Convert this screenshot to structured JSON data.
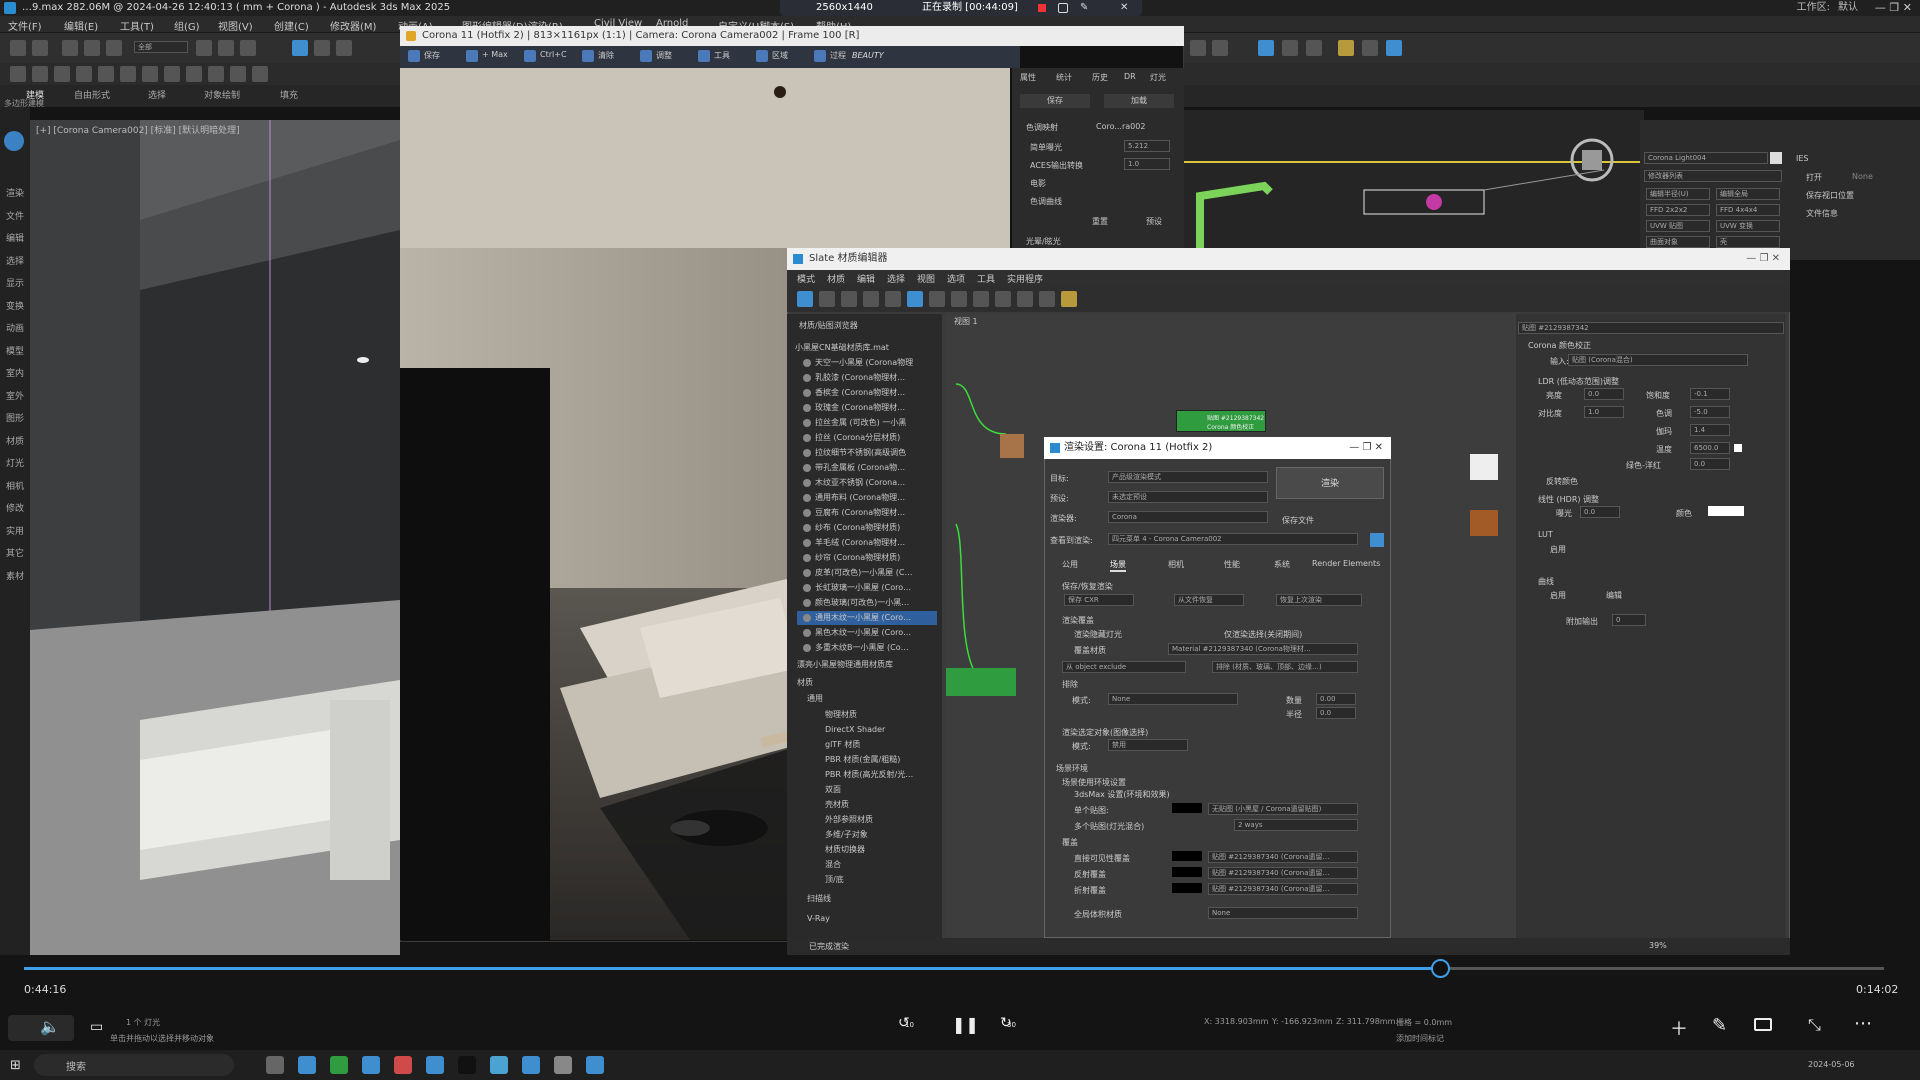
{
  "titlebar": {
    "title": "…9.max  282.06M @ 2024-04-26 12:40:13  ( mm + Corona ) - Autodesk 3ds Max 2025",
    "rec_res": "2560x1440",
    "rec_status": "正在录制 [00:44:09]",
    "workspace": "工作区:",
    "default": "默认"
  },
  "menu": [
    "文件(F)",
    "编辑(E)",
    "工具(T)",
    "组(G)",
    "视图(V)",
    "创建(C)",
    "修改器(M)",
    "动画(A)",
    "图形编辑器(D)",
    "渲染(R)",
    "Civil View",
    "Arnold",
    "自定义(U)",
    "脚本(S)",
    "帮助(H)"
  ],
  "toolbar": {
    "selector": "全部",
    "cmd_label": "多边形建模"
  },
  "ribbon_tabs": [
    "建模",
    "自由形式",
    "选择",
    "对象绘制",
    "填充"
  ],
  "left_items": [
    "渲染",
    "文件",
    "编辑",
    "选择",
    "显示",
    "变换",
    "动画",
    "模型",
    "室内",
    "室外",
    "图形",
    "材质",
    "灯光",
    "相机",
    "修改",
    "实用",
    "其它",
    "素材"
  ],
  "viewport_label": "[+] [Corona Camera002] [标准] [默认明暗处理]",
  "render_frame": {
    "title": "Corona 11 (Hotfix 2) | 813×1161px (1:1) | Camera: Corona Camera002 | Frame 100 [R]",
    "tools": [
      "保存",
      "+ Max",
      "Ctrl+C",
      "清除",
      "调整",
      "工具",
      "区域",
      "过程"
    ],
    "channel": "BEAUTY",
    "side_tabs": [
      "属性",
      "统计",
      "历史",
      "DR",
      "灯光"
    ],
    "save": "保存",
    "load": "加载",
    "tone_mapping": "色调映射",
    "tm_value": "Coro...ra002",
    "exposure": "简单曝光",
    "exposure_val": "5.212",
    "aces": "ACES输出转换",
    "aces_val": "1.0",
    "filmic": "电影",
    "curve": "色调曲线",
    "reset": "重置",
    "preset": "预设",
    "bloom": "光晕/眩光"
  },
  "cmd_panel": {
    "light_name": "Corona Light004",
    "modifier_list": "修改器列表",
    "ies": "IES",
    "on": "打开",
    "none": "None",
    "btns": [
      "编辑半径(U)",
      "编辑全局",
      "FFD 2x2x2",
      "FFD 4x4x4",
      "UVW 贴图",
      "UVW 变换",
      "曲面对象",
      "壳"
    ],
    "keep_viewport": "保存视口位置",
    "file_info": "文件信息"
  },
  "slate": {
    "title": "Slate 材质编辑器",
    "menu": [
      "模式",
      "材质",
      "编辑",
      "选择",
      "视图",
      "选项",
      "工具",
      "实用程序"
    ],
    "browser_header": "材质/贴图浏览器",
    "view_tab": "视图 1",
    "library": "小黑屋CN基础材质库.mat",
    "library2": "漂亮小黑屋物理通用材质库",
    "materials_header": "材质",
    "general": "通用",
    "scanline": "扫描线",
    "vray": "V-Ray",
    "status": "已完成渲染",
    "zoom": "39%",
    "items": [
      "天空一小黑屋 (Corona物理",
      "乳胶漆 (Corona物理材…",
      "香槟金 (Corona物理材…",
      "玫瑰金 (Corona物理材…",
      "拉丝金属 (可改色) 一小黑",
      "拉丝 (Corona分层材质)",
      "拉纹细节不锈钢(高级调色",
      "带孔金属板 (Corona物…",
      "木纹亚不锈钢 (Corona…",
      "通用布料 (Corona物理…",
      "豆腐布 (Corona物理材…",
      "纱布 (Corona物理材质)",
      "羊毛绒 (Corona物理材…",
      "纱帘 (Corona物理材质)",
      "皮革(可改色)一小黑屋 (C…",
      "长虹玻璃一小黑屋 (Coro…",
      "颜色玻璃(可改色)一小黑…",
      "通用木纹一小黑屋 (Coro…",
      "黑色木纹一小黑屋 (Coro…",
      "多重木纹B一小黑屋 (Co…"
    ],
    "general_items": [
      "物理材质",
      "DirectX Shader",
      "glTF 材质",
      "PBR 材质(金属/粗糙)",
      "PBR 材质(高光反射/光…",
      "双面",
      "壳材质",
      "外部参照材质",
      "多维/子对象",
      "材质切换器",
      "混合",
      "顶/底"
    ],
    "node_title": "贴图 #2129387342",
    "node_sub": "Corona 颜色校正",
    "param_header": "贴图 #2129387342",
    "param_section": "Corona 颜色校正",
    "input": "输入:",
    "input_val": "贴图 (Corona混合)",
    "ldr": "LDR (低动态范围)调整",
    "brightness": "亮度",
    "saturation": "饱和度",
    "contrast": "对比度",
    "hue": "色调",
    "gamma": "伽玛",
    "temperature": "温度",
    "temp_val": "6500.0",
    "tint": "绿色-洋红",
    "invert": "反转颜色",
    "hdr": "线性 (HDR) 调整",
    "exposure": "曝光",
    "color": "颜色",
    "lut": "LUT",
    "enable": "启用",
    "curves": "曲线",
    "edit": "编辑",
    "add_output": "附加输出",
    "v_bright": "0.0",
    "v_sat": "-0.1",
    "v_contrast": "1.0",
    "v_hue": "-5.0",
    "v_gamma": "1.4",
    "v_tint": "0.0",
    "v_exposure": "0.0",
    "v_add": "0"
  },
  "render_setup": {
    "title": "渲染设置: Corona 11 (Hotfix 2)",
    "target": "目标:",
    "target_val": "产品级渲染模式",
    "preset": "预设:",
    "preset_val": "未选定预设",
    "renderer": "渲染器:",
    "renderer_val": "Corona",
    "save_file": "保存文件",
    "view": "查看到渲染:",
    "view_val": "四元菜单 4 - Corona Camera002",
    "render_btn": "渲染",
    "tabs": [
      "公用",
      "场景",
      "相机",
      "性能",
      "系统",
      "Render Elements"
    ],
    "save_cxr": "保存/恢复渲染",
    "save_cxr_btn": "保存 CXR",
    "from_file": "从文件恢复",
    "restore_last": "恢复上次渲染",
    "override": "渲染覆盖",
    "hidden_lights": "渲染隐藏灯光",
    "only_selected": "仅渲染选择(关闭期间)",
    "override_mtl": "覆盖材质",
    "override_mtl_val": "Material #2129387340 (Corona物理材…",
    "exclude": "从 object exclude",
    "exclude_val": "排除 (材质、玻璃、顶部、边缘…)",
    "mask": "排除",
    "mode": "模式:",
    "mode_val": "None",
    "amount": "数量",
    "amount_val": "0.00",
    "radius": "半径",
    "radius_val": "0.0",
    "selected_only": "渲染选定对象(图像选择)",
    "sel_mode": "禁用",
    "env": "场景环境",
    "env_settings": "场景使用环境设置",
    "use_3ds": "3dsMax 设置(环境和效果)",
    "single_map": "单个贴图:",
    "single_map_val": "无贴图 (小黑屋 / Corona遗留贴图)",
    "multi_map": "多个贴图(灯光混合)",
    "ways": "2 ways",
    "overrides": "覆盖",
    "direct_vis": "直接可见性覆盖",
    "reflect": "反射覆盖",
    "refract": "折射覆盖",
    "map_a": "贴图 #2129387340 (Corona遗留…",
    "global_vol": "全局体积材质",
    "global_vol_val": "None"
  },
  "player": {
    "elapsed": "0:44:16",
    "remaining": "0:14:02",
    "progress": 0.7613,
    "skip_back": "10",
    "skip_fwd": "30",
    "sub_label": "1 个 灯光",
    "hint": "单击并拖动以选择并移动对象"
  },
  "statusbar": {
    "x": "X: 3318.903mm",
    "y": "Y: -166.923mm",
    "z": "Z: 311.798mm",
    "grid": "栅格 = 0.0mm",
    "addtime": "添加时间标记"
  },
  "taskbar": {
    "search": "搜索",
    "date": "2024-05-06"
  }
}
